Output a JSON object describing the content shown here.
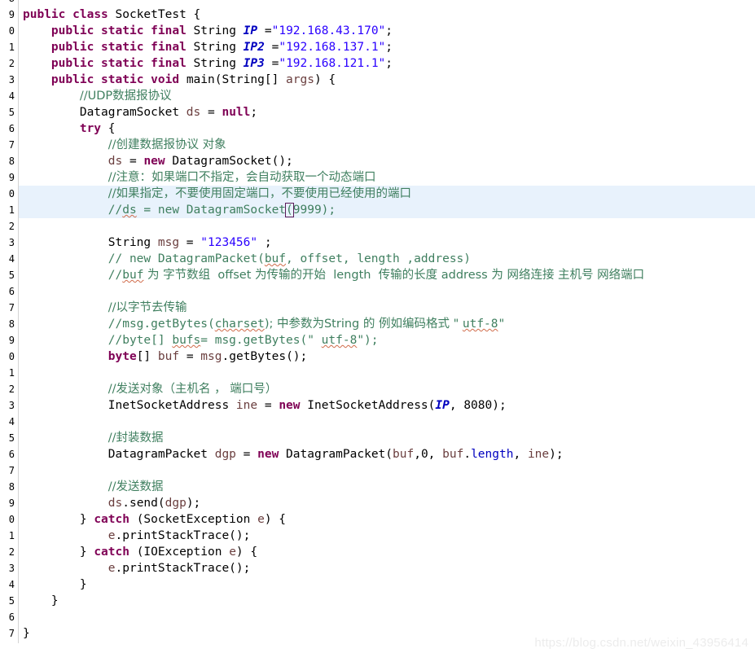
{
  "editor": {
    "language": "java",
    "file_class": "SocketTest",
    "line_height_px": 20,
    "first_visible_line_partial": true,
    "highlighted_line_index": 12,
    "colors": {
      "background": "#ffffff",
      "gutter_text": "#9aa4b0",
      "gutter_border": "#d4d4d4",
      "keyword": "#7f0055",
      "string": "#2a00ff",
      "comment": "#3f7f5f",
      "field": "#0000c0",
      "local_var": "#6a3e3e",
      "plain_text": "#000000",
      "current_line_highlight": "#e8f2fc",
      "spellcheck_squiggle": "#d06b4a",
      "bracket_match_border": "#5a1a5a",
      "watermark": "#ececec"
    }
  },
  "gutter": {
    "line_numbers": [
      "8",
      "9",
      "0",
      "1",
      "2",
      "3",
      "4",
      "5",
      "6",
      "7",
      "8",
      "9",
      "0",
      "1",
      "2",
      "3",
      "4",
      "5",
      "6",
      "7",
      "8",
      "9",
      "0",
      "1",
      "2",
      "3",
      "4",
      "5",
      "6",
      "7",
      "8",
      "9",
      "0",
      "1",
      "2",
      "3",
      "4",
      "5",
      "6",
      "7",
      "8"
    ],
    "fold_marker_rows": [
      5
    ],
    "note": "Line number column is clipped at the left edge of the screenshot; only the last digit of each number is visible."
  },
  "watermark": {
    "text": "https://blog.csdn.net/weixin_43956414"
  },
  "code": {
    "lines": [
      {
        "indent": 0,
        "tokens": []
      },
      {
        "indent": 0,
        "tokens": [
          {
            "t": "public",
            "c": "kw"
          },
          {
            "t": " ",
            "c": "plain"
          },
          {
            "t": "class",
            "c": "kw"
          },
          {
            "t": " SocketTest {",
            "c": "plain"
          }
        ]
      },
      {
        "indent": 1,
        "tokens": [
          {
            "t": "public",
            "c": "kw"
          },
          {
            "t": " ",
            "c": "plain"
          },
          {
            "t": "static",
            "c": "kw"
          },
          {
            "t": " ",
            "c": "plain"
          },
          {
            "t": "final",
            "c": "kw"
          },
          {
            "t": " String ",
            "c": "plain"
          },
          {
            "t": "IP",
            "c": "fld"
          },
          {
            "t": " =",
            "c": "plain"
          },
          {
            "t": "\"192.168.43.170\"",
            "c": "str"
          },
          {
            "t": ";",
            "c": "plain"
          }
        ]
      },
      {
        "indent": 1,
        "tokens": [
          {
            "t": "public",
            "c": "kw"
          },
          {
            "t": " ",
            "c": "plain"
          },
          {
            "t": "static",
            "c": "kw"
          },
          {
            "t": " ",
            "c": "plain"
          },
          {
            "t": "final",
            "c": "kw"
          },
          {
            "t": " String ",
            "c": "plain"
          },
          {
            "t": "IP2",
            "c": "fld"
          },
          {
            "t": " =",
            "c": "plain"
          },
          {
            "t": "\"192.168.137.1\"",
            "c": "str"
          },
          {
            "t": ";",
            "c": "plain"
          }
        ]
      },
      {
        "indent": 1,
        "tokens": [
          {
            "t": "public",
            "c": "kw"
          },
          {
            "t": " ",
            "c": "plain"
          },
          {
            "t": "static",
            "c": "kw"
          },
          {
            "t": " ",
            "c": "plain"
          },
          {
            "t": "final",
            "c": "kw"
          },
          {
            "t": " String ",
            "c": "plain"
          },
          {
            "t": "IP3",
            "c": "fld"
          },
          {
            "t": " =",
            "c": "plain"
          },
          {
            "t": "\"192.168.121.1\"",
            "c": "str"
          },
          {
            "t": ";",
            "c": "plain"
          }
        ]
      },
      {
        "indent": 1,
        "tokens": [
          {
            "t": "public",
            "c": "kw"
          },
          {
            "t": " ",
            "c": "plain"
          },
          {
            "t": "static",
            "c": "kw"
          },
          {
            "t": " ",
            "c": "plain"
          },
          {
            "t": "void",
            "c": "kw"
          },
          {
            "t": " main(String[] ",
            "c": "plain"
          },
          {
            "t": "args",
            "c": "var"
          },
          {
            "t": ") {",
            "c": "plain"
          }
        ]
      },
      {
        "indent": 2,
        "tokens": [
          {
            "t": "//UDP数据报协议",
            "c": "cmt cjk"
          }
        ]
      },
      {
        "indent": 2,
        "tokens": [
          {
            "t": "DatagramSocket ",
            "c": "plain"
          },
          {
            "t": "ds",
            "c": "var"
          },
          {
            "t": " = ",
            "c": "plain"
          },
          {
            "t": "null",
            "c": "kw"
          },
          {
            "t": ";",
            "c": "plain"
          }
        ]
      },
      {
        "indent": 2,
        "tokens": [
          {
            "t": "try",
            "c": "kw"
          },
          {
            "t": " {",
            "c": "plain"
          }
        ]
      },
      {
        "indent": 3,
        "tokens": [
          {
            "t": "//创建数据报协议 对象",
            "c": "cmt cjk"
          }
        ]
      },
      {
        "indent": 3,
        "tokens": [
          {
            "t": "ds",
            "c": "var"
          },
          {
            "t": " = ",
            "c": "plain"
          },
          {
            "t": "new",
            "c": "kw"
          },
          {
            "t": " DatagramSocket();",
            "c": "plain"
          }
        ]
      },
      {
        "indent": 3,
        "tokens": [
          {
            "t": "//注意：如果端口不指定，会自动获取一个动态端口",
            "c": "cmt cjk"
          }
        ]
      },
      {
        "indent": 3,
        "tokens": [
          {
            "t": "//如果指定，不要使用固定端口，不要使用已经使用的端口",
            "c": "cmt cjk"
          }
        ]
      },
      {
        "indent": 3,
        "highlight": true,
        "tokens": [
          {
            "t": "//",
            "c": "cmt"
          },
          {
            "t": "ds",
            "c": "cmt sq"
          },
          {
            "t": " = new DatagramSocket",
            "c": "cmt"
          },
          {
            "t": "(",
            "c": "cmt brkt"
          },
          {
            "t": "9999);",
            "c": "cmt"
          }
        ]
      },
      {
        "indent": 0,
        "tokens": []
      },
      {
        "indent": 3,
        "tokens": [
          {
            "t": "String ",
            "c": "plain"
          },
          {
            "t": "msg",
            "c": "var"
          },
          {
            "t": " = ",
            "c": "plain"
          },
          {
            "t": "\"123456\"",
            "c": "str"
          },
          {
            "t": " ;",
            "c": "plain"
          }
        ]
      },
      {
        "indent": 3,
        "tokens": [
          {
            "t": "// new DatagramPacket(",
            "c": "cmt"
          },
          {
            "t": "buf",
            "c": "cmt sq"
          },
          {
            "t": ", offset, length ,address)",
            "c": "cmt"
          }
        ]
      },
      {
        "indent": 3,
        "tokens": [
          {
            "t": "//",
            "c": "cmt"
          },
          {
            "t": "buf",
            "c": "cmt sq"
          },
          {
            "t": " 为 字节数组  offset 为传输的开始  length  传输的长度 address 为 网络连接 主机号 网络端口",
            "c": "cmt cjk"
          }
        ]
      },
      {
        "indent": 0,
        "tokens": []
      },
      {
        "indent": 3,
        "tokens": [
          {
            "t": "//以字节去传输",
            "c": "cmt cjk"
          }
        ]
      },
      {
        "indent": 3,
        "tokens": [
          {
            "t": "//msg.getBytes(",
            "c": "cmt"
          },
          {
            "t": "charset",
            "c": "cmt sq"
          },
          {
            "t": "); 中参数为String 的 例如编码格式 \" ",
            "c": "cmt cjk"
          },
          {
            "t": "utf-8",
            "c": "cmt sq"
          },
          {
            "t": "\"",
            "c": "cmt"
          }
        ]
      },
      {
        "indent": 3,
        "tokens": [
          {
            "t": "//byte[] ",
            "c": "cmt"
          },
          {
            "t": "bufs",
            "c": "cmt sq"
          },
          {
            "t": "= msg.getBytes(\" ",
            "c": "cmt"
          },
          {
            "t": "utf-8",
            "c": "cmt sq"
          },
          {
            "t": "\");",
            "c": "cmt"
          }
        ]
      },
      {
        "indent": 3,
        "tokens": [
          {
            "t": "byte",
            "c": "kw"
          },
          {
            "t": "[] ",
            "c": "plain"
          },
          {
            "t": "buf",
            "c": "var"
          },
          {
            "t": " = ",
            "c": "plain"
          },
          {
            "t": "msg",
            "c": "var"
          },
          {
            "t": ".getBytes();",
            "c": "plain"
          }
        ]
      },
      {
        "indent": 0,
        "tokens": []
      },
      {
        "indent": 3,
        "tokens": [
          {
            "t": "//发送对象（主机名 ， 端口号）",
            "c": "cmt cjk"
          }
        ]
      },
      {
        "indent": 3,
        "tokens": [
          {
            "t": "InetSocketAddress ",
            "c": "plain"
          },
          {
            "t": "ine",
            "c": "var"
          },
          {
            "t": " = ",
            "c": "plain"
          },
          {
            "t": "new",
            "c": "kw"
          },
          {
            "t": " InetSocketAddress(",
            "c": "plain"
          },
          {
            "t": "IP",
            "c": "fld"
          },
          {
            "t": ", 8080);",
            "c": "plain"
          }
        ]
      },
      {
        "indent": 0,
        "tokens": []
      },
      {
        "indent": 3,
        "tokens": [
          {
            "t": "//封装数据",
            "c": "cmt cjk"
          }
        ]
      },
      {
        "indent": 3,
        "tokens": [
          {
            "t": "DatagramPacket ",
            "c": "plain"
          },
          {
            "t": "dgp",
            "c": "var"
          },
          {
            "t": " = ",
            "c": "plain"
          },
          {
            "t": "new",
            "c": "kw"
          },
          {
            "t": " DatagramPacket(",
            "c": "plain"
          },
          {
            "t": "buf",
            "c": "var"
          },
          {
            "t": ",0, ",
            "c": "plain"
          },
          {
            "t": "buf",
            "c": "var"
          },
          {
            "t": ".",
            "c": "plain"
          },
          {
            "t": "length",
            "c": "fldn"
          },
          {
            "t": ", ",
            "c": "plain"
          },
          {
            "t": "ine",
            "c": "var"
          },
          {
            "t": ");",
            "c": "plain"
          }
        ]
      },
      {
        "indent": 0,
        "tokens": []
      },
      {
        "indent": 3,
        "tokens": [
          {
            "t": "//发送数据",
            "c": "cmt cjk"
          }
        ]
      },
      {
        "indent": 3,
        "tokens": [
          {
            "t": "ds",
            "c": "var"
          },
          {
            "t": ".send(",
            "c": "plain"
          },
          {
            "t": "dgp",
            "c": "var"
          },
          {
            "t": ");",
            "c": "plain"
          }
        ]
      },
      {
        "indent": 2,
        "tokens": [
          {
            "t": "} ",
            "c": "plain"
          },
          {
            "t": "catch",
            "c": "kw"
          },
          {
            "t": " (SocketException ",
            "c": "plain"
          },
          {
            "t": "e",
            "c": "var"
          },
          {
            "t": ") {",
            "c": "plain"
          }
        ]
      },
      {
        "indent": 3,
        "tokens": [
          {
            "t": "e",
            "c": "var"
          },
          {
            "t": ".printStackTrace();",
            "c": "plain"
          }
        ]
      },
      {
        "indent": 2,
        "tokens": [
          {
            "t": "} ",
            "c": "plain"
          },
          {
            "t": "catch",
            "c": "kw"
          },
          {
            "t": " (IOException ",
            "c": "plain"
          },
          {
            "t": "e",
            "c": "var"
          },
          {
            "t": ") {",
            "c": "plain"
          }
        ]
      },
      {
        "indent": 3,
        "tokens": [
          {
            "t": "e",
            "c": "var"
          },
          {
            "t": ".printStackTrace();",
            "c": "plain"
          }
        ]
      },
      {
        "indent": 2,
        "tokens": [
          {
            "t": "}",
            "c": "plain"
          }
        ]
      },
      {
        "indent": 1,
        "tokens": [
          {
            "t": "}",
            "c": "plain"
          }
        ]
      },
      {
        "indent": 0,
        "tokens": []
      },
      {
        "indent": 0,
        "tokens": [
          {
            "t": "}",
            "c": "plain"
          }
        ]
      },
      {
        "indent": 0,
        "tokens": []
      }
    ]
  }
}
